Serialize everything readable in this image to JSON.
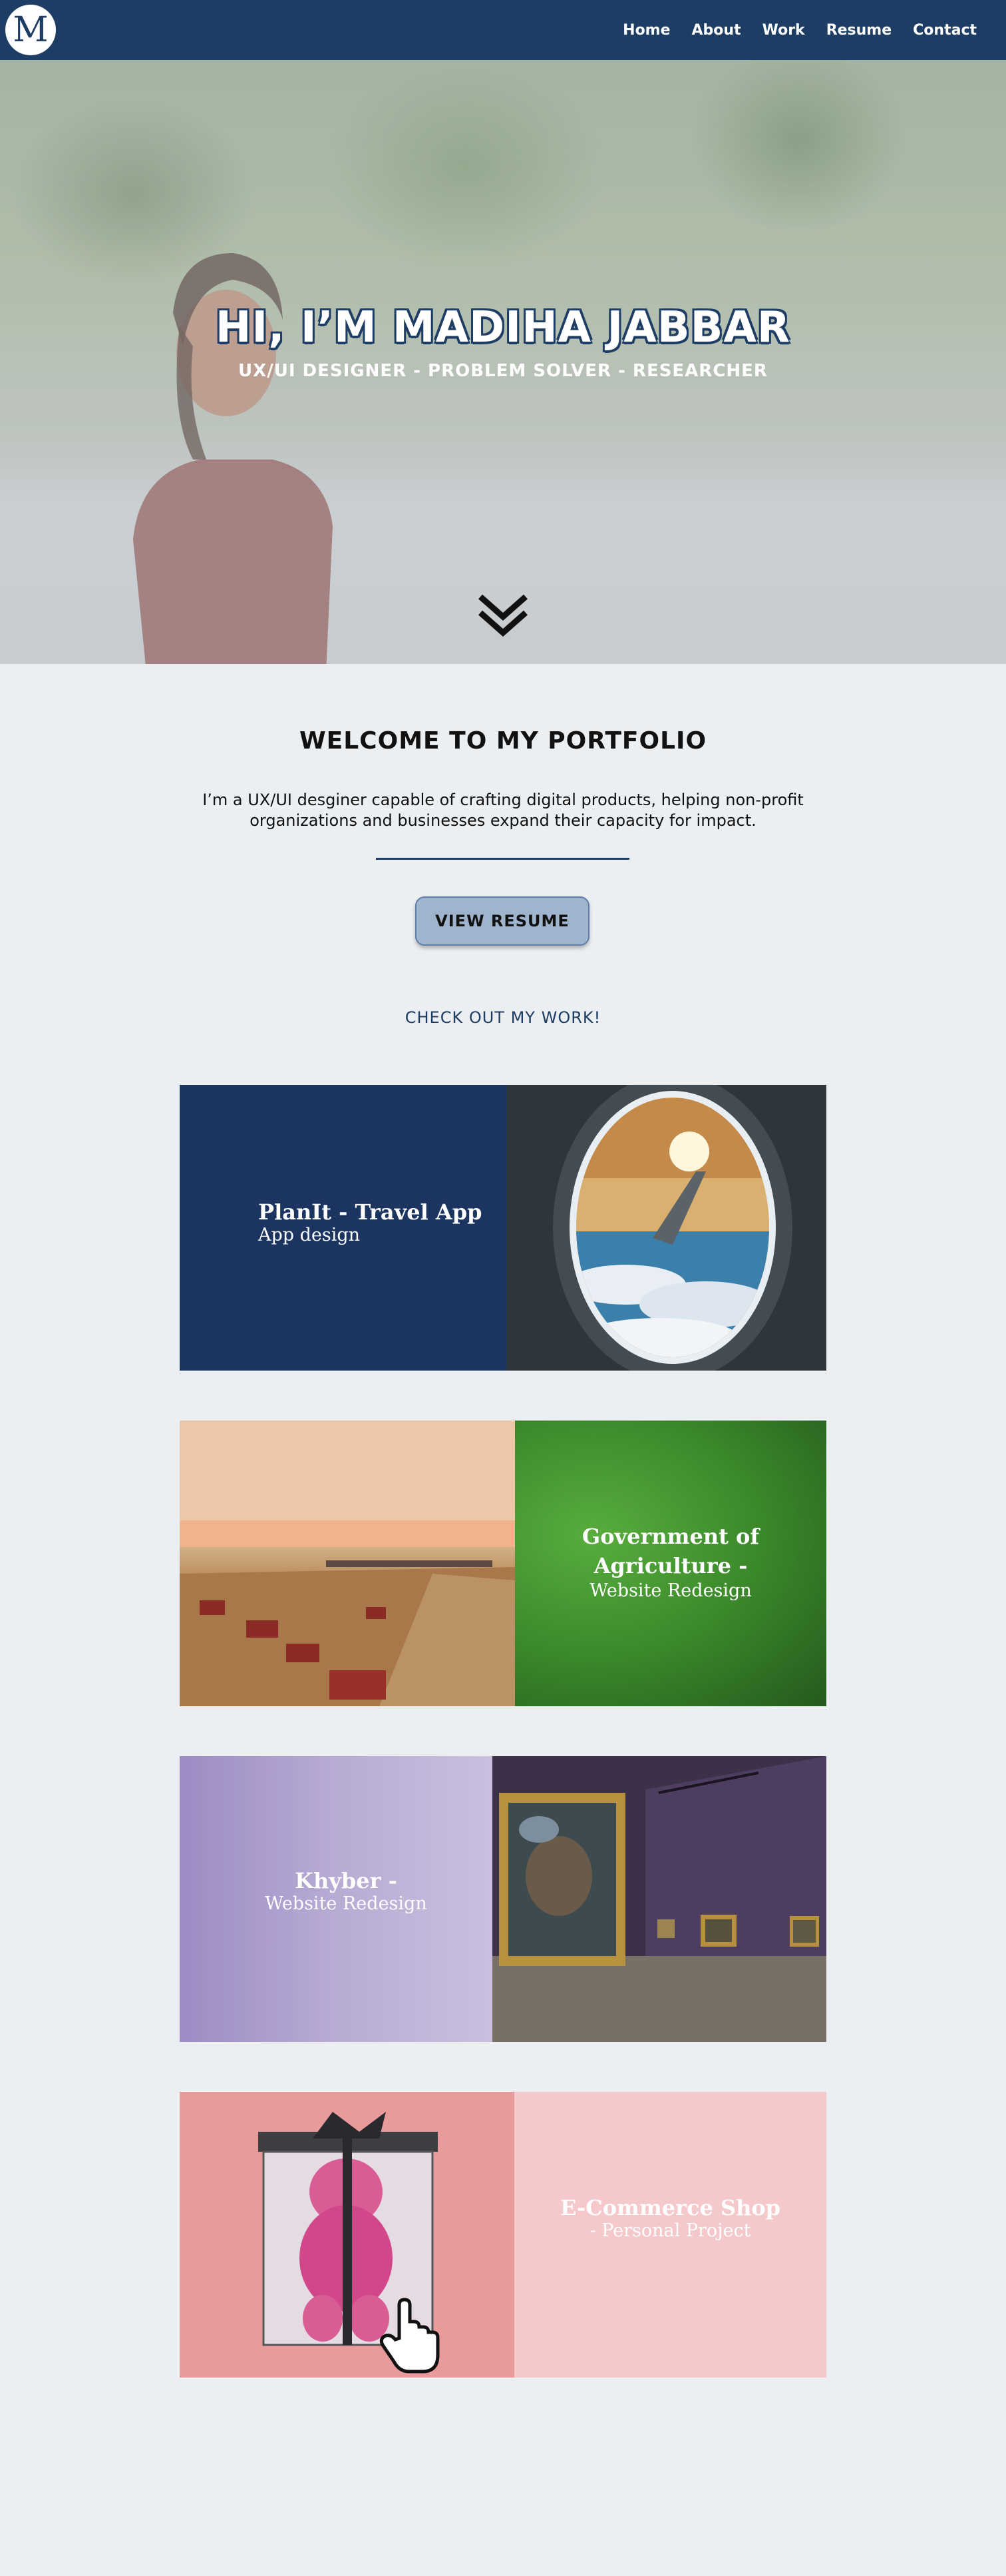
{
  "nav": {
    "logo_letter": "M",
    "links": [
      "Home",
      "About",
      "Work",
      "Resume",
      "Contact"
    ]
  },
  "hero": {
    "title": "HI, I’M MADIHA JABBAR",
    "subtitle": "UX/UI DESIGNER - PROBLEM SOLVER - RESEARCHER",
    "scroll_icon": "double-chevron-down-icon"
  },
  "welcome": {
    "title": "WELCOME TO MY PORTFOLIO",
    "text": "I’m a UX/UI desginer capable of crafting digital products, helping non-profit organizations and businesses expand their capacity for impact.",
    "resume_button": "VIEW RESUME",
    "work_heading": "CHECK OUT MY WORK!"
  },
  "projects": [
    {
      "title": "PlanIt - Travel App",
      "subtitle": "App design"
    },
    {
      "title": "Government of Agriculture -",
      "subtitle": "Website Redesign"
    },
    {
      "title": "Khyber -",
      "subtitle": "Website Redesign"
    },
    {
      "title": "E-Commerce Shop",
      "subtitle": "- Personal Project"
    }
  ],
  "colors": {
    "navy": "#1e3d64",
    "background": "#eceff2",
    "button": "#9fb4cd",
    "card_planit": "#1b3460",
    "card_agri": "#3e8d2d",
    "card_khyber": "#b8abd4",
    "card_shop": "#f5c9cb"
  }
}
